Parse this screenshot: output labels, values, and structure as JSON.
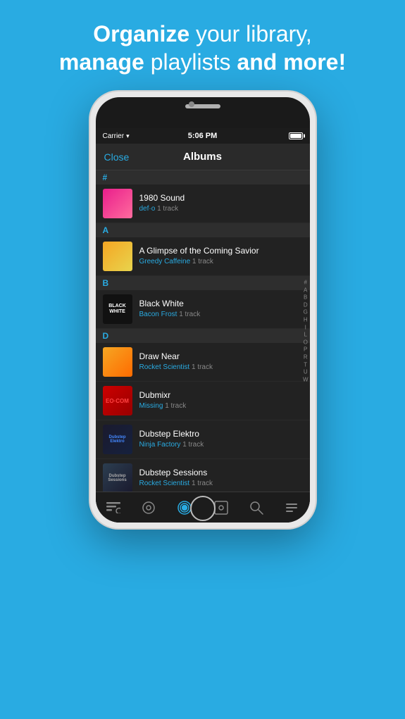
{
  "header": {
    "line1_normal": "your library,",
    "line1_bold": "Organize",
    "line2_normal": "playlists ",
    "line2_bold_1": "manage",
    "line2_bold_2": "and more!"
  },
  "status_bar": {
    "carrier": "Carrier",
    "time": "5:06 PM"
  },
  "nav": {
    "close_label": "Close",
    "title": "Albums"
  },
  "sections": {
    "hash": "#",
    "a": "A",
    "b": "B",
    "d": "D"
  },
  "albums": [
    {
      "title": "1980 Sound",
      "artist": "def·o",
      "tracks": "1 track",
      "art_class": "art-1980",
      "art_text": ""
    },
    {
      "title": "A Glimpse of the Coming Savior",
      "artist": "Greedy Caffeine",
      "tracks": "1 track",
      "art_class": "art-glimpse",
      "art_text": ""
    },
    {
      "title": "Black White",
      "artist": "Bacon Frost",
      "tracks": "1 track",
      "art_class": "art-black",
      "art_text": "BLACK\nWHITE"
    },
    {
      "title": "Draw Near",
      "artist": "Rocket Scientist",
      "tracks": "1 track",
      "art_class": "art-draw",
      "art_text": ""
    },
    {
      "title": "Dubmixr",
      "artist": "Missing",
      "tracks": "1 track",
      "art_class": "art-dubmixr",
      "art_text": ""
    },
    {
      "title": "Dubstep Elektro",
      "artist": "Ninja Factory",
      "tracks": "1 track",
      "art_class": "art-dubstep-e",
      "art_text": ""
    },
    {
      "title": "Dubstep Sessions",
      "artist": "Rocket Scientist",
      "tracks": "1 track",
      "art_class": "art-dubstep-s",
      "art_text": ""
    }
  ],
  "alpha_index": [
    "#",
    "A",
    "B",
    "D",
    "G",
    "H",
    "I",
    "L",
    "O",
    "P",
    "R",
    "T",
    "U",
    "W"
  ],
  "tab_bar": {
    "items": [
      {
        "icon": "☰",
        "name": "menu",
        "active": false
      },
      {
        "icon": "◎",
        "name": "search-vinyl",
        "active": false
      },
      {
        "icon": "⊙",
        "name": "now-playing",
        "active": true
      },
      {
        "icon": "◫",
        "name": "playlist",
        "active": false
      },
      {
        "icon": "⌕",
        "name": "search",
        "active": false
      },
      {
        "icon": "♪",
        "name": "more",
        "active": false
      }
    ]
  }
}
